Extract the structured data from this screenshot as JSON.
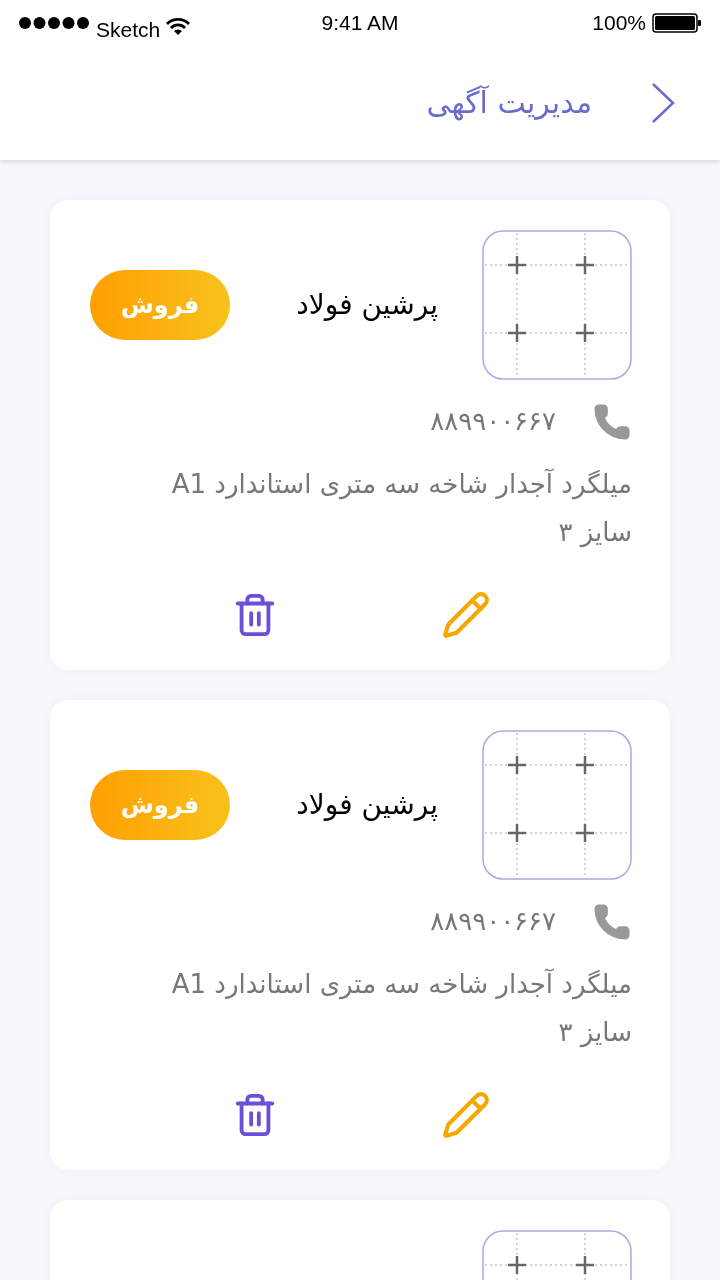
{
  "status_bar": {
    "carrier": "Sketch",
    "time": "9:41 AM",
    "battery": "100%"
  },
  "header": {
    "title": "مدیریت آگهی"
  },
  "cards": [
    {
      "kind": "full",
      "name": "پرشین فولاد",
      "badge": "فروش",
      "phone": "۸۸۹۹۰۰۶۶۷",
      "description": "میلگرد آجدار شاخه سه متری استاندارد A1 سایز ۳"
    },
    {
      "kind": "full",
      "name": "پرشین فولاد",
      "badge": "فروش",
      "phone": "۸۸۹۹۰۰۶۶۷",
      "description": "میلگرد آجدار شاخه سه متری استاندارد A1 سایز ۳"
    },
    {
      "kind": "partial"
    }
  ]
}
